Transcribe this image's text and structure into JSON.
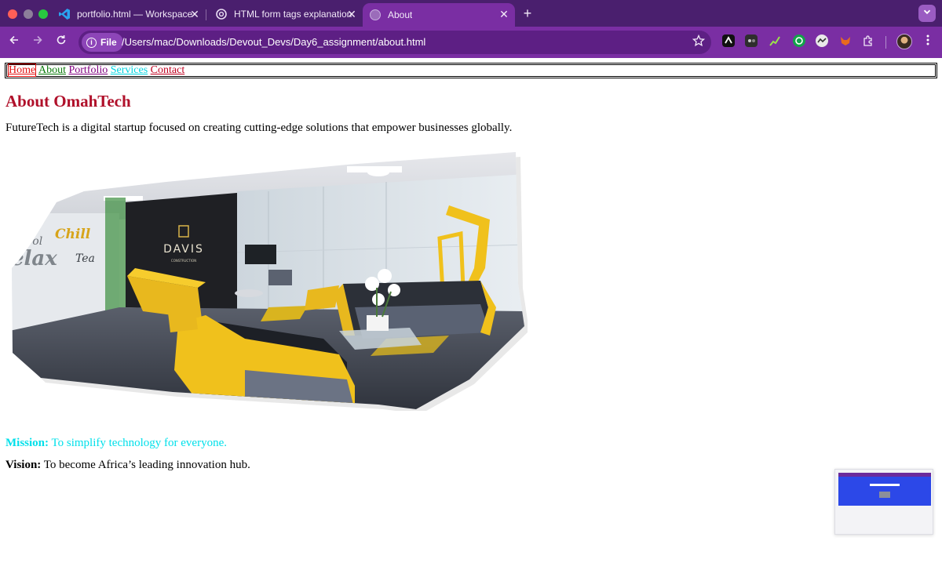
{
  "browser": {
    "tabs": [
      {
        "title": "portfolio.html — Workspace –",
        "active": false
      },
      {
        "title": "HTML form tags explanation",
        "active": false
      },
      {
        "title": "About",
        "active": true
      }
    ],
    "close_glyph": "✕",
    "new_tab_glyph": "+",
    "chip_label": "File",
    "url": "/Users/mac/Downloads/Devout_Devs/Day6_assignment/about.html",
    "theme_color": "#7a2ea3"
  },
  "nav": {
    "links": [
      "Home",
      "About",
      "Portfolio",
      "Services",
      "Contact"
    ]
  },
  "page": {
    "heading": "About OmahTech",
    "intro": "FutureTech is a digital startup focused on creating cutting-edge solutions that empower businesses globally.",
    "photo": {
      "wall_text_1": "Pool",
      "wall_text_2": "Chill",
      "wall_text_3": "elax",
      "wall_text_4": "Tea",
      "brand": "DAVIS",
      "brand_sub": "CONSTRUCTION"
    },
    "mission_label": "Mission:",
    "mission_text": " To simplify technology for everyone.",
    "vision_label": "Vision:",
    "vision_text": " To become Africa’s leading innovation hub."
  }
}
